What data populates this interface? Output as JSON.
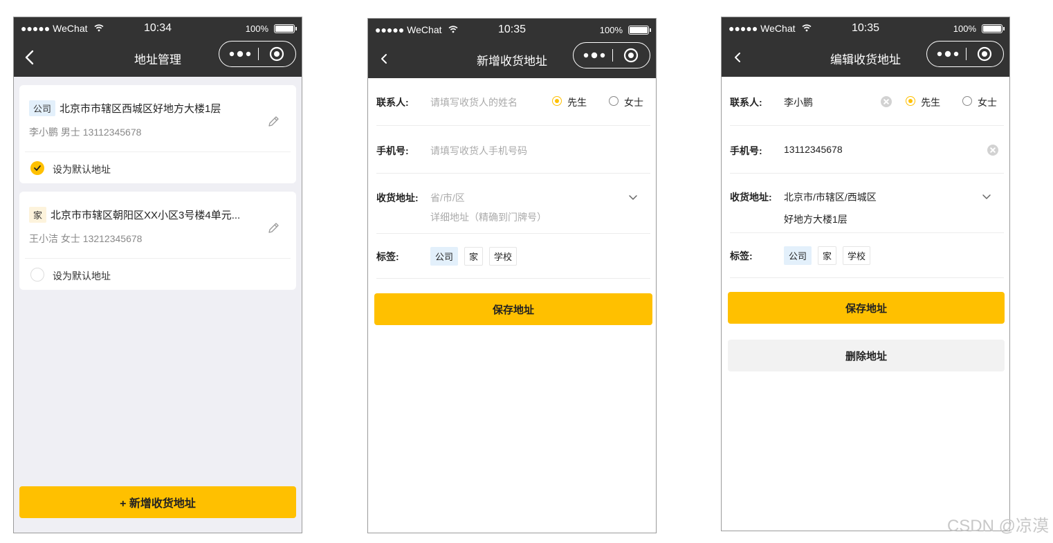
{
  "statusbar": {
    "carrier": "●●●●● WeChat",
    "battery": "100%",
    "time_1": "10:34",
    "time_2": "10:35",
    "time_3": "10:35"
  },
  "screen1": {
    "title": "地址管理",
    "addresses": [
      {
        "tag": "公司",
        "address": "北京市市辖区西城区好地方大楼1层",
        "contact": "李小鹏 男士  13112345678",
        "default_label": "设为默认地址",
        "is_default": true
      },
      {
        "tag": "家",
        "address": "北京市市辖区朝阳区XX小区3号楼4单元...",
        "contact": "王小洁 女士  13212345678",
        "default_label": "设为默认地址",
        "is_default": false
      }
    ],
    "add_button": "+ 新增收货地址"
  },
  "screen2": {
    "title": "新增收货地址",
    "contact_label": "联系人:",
    "contact_placeholder": "请填写收货人的姓名",
    "gender_male": "先生",
    "gender_female": "女士",
    "phone_label": "手机号:",
    "phone_placeholder": "请填写收货人手机号码",
    "address_label": "收货地址:",
    "region_placeholder": "省/市/区",
    "detail_placeholder": "详细地址（精确到门牌号）",
    "tag_label": "标签:",
    "tags": [
      "公司",
      "家",
      "学校"
    ],
    "save_button": "保存地址"
  },
  "screen3": {
    "title": "编辑收货地址",
    "contact_label": "联系人:",
    "contact_value": "李小鹏",
    "gender_male": "先生",
    "gender_female": "女士",
    "phone_label": "手机号:",
    "phone_value": "13112345678",
    "address_label": "收货地址:",
    "region_value": "北京市/市辖区/西城区",
    "detail_value": "好地方大楼1层",
    "tag_label": "标签:",
    "tags": [
      "公司",
      "家",
      "学校"
    ],
    "save_button": "保存地址",
    "delete_button": "删除地址"
  },
  "watermark": "CSDN @凉漠",
  "colors": {
    "accent": "#ffc000",
    "navbar": "#333333",
    "tag_selected": "#e3f0fb"
  }
}
